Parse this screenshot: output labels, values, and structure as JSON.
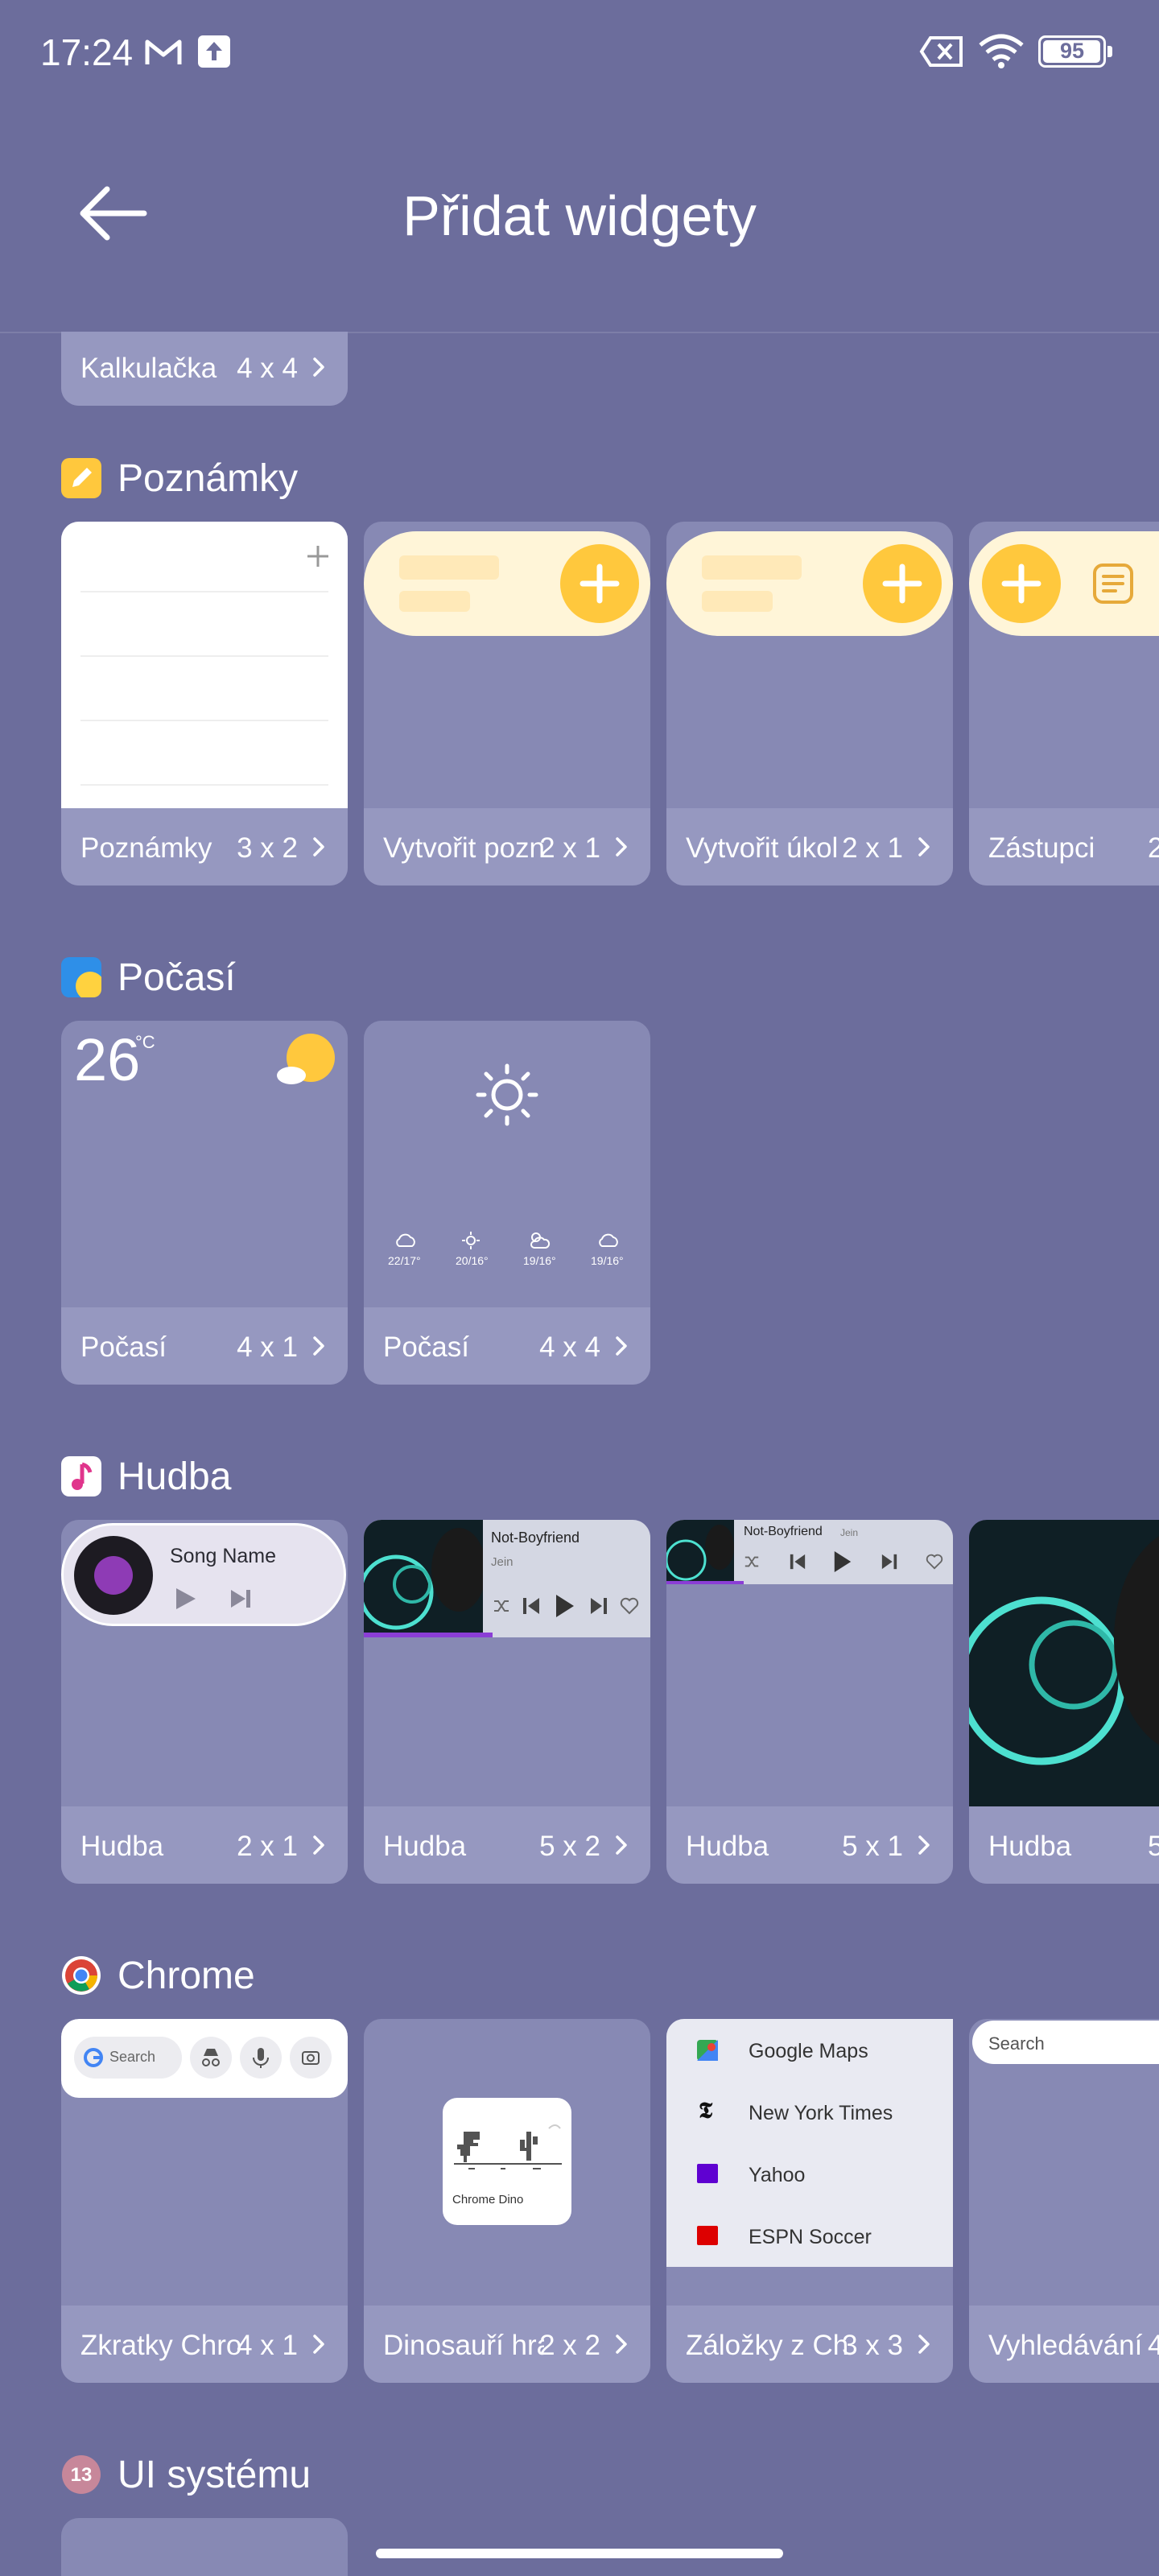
{
  "status_bar": {
    "time": "17:24",
    "battery": "95"
  },
  "header": {
    "title": "Přidat widgety"
  },
  "calc_card": {
    "name": "Kalkulačka",
    "size": "4 x 4"
  },
  "sections": {
    "notes": {
      "title": "Poznámky",
      "cards": [
        {
          "name": "Poznámky",
          "size": "3 x 2"
        },
        {
          "name": "Vytvořit pozn",
          "size": "2 x 1"
        },
        {
          "name": "Vytvořit úkol",
          "size": "2 x 1"
        },
        {
          "name": "Zástupci",
          "size": "2"
        }
      ]
    },
    "weather": {
      "title": "Počasí",
      "temp": "26",
      "unit": "°C",
      "forecast": [
        "22/17°",
        "20/16°",
        "19/16°",
        "19/16°"
      ],
      "cards": [
        {
          "name": "Počasí",
          "size": "4 x 1"
        },
        {
          "name": "Počasí",
          "size": "4 x 4"
        }
      ]
    },
    "music": {
      "title": "Hudba",
      "song_name": "Song Name",
      "track_title": "Not-Boyfriend",
      "track_artist": "Jein",
      "track_title_short": "Not-Boyfriend",
      "track_artist_short": "Jein",
      "cards": [
        {
          "name": "Hudba",
          "size": "2 x 1"
        },
        {
          "name": "Hudba",
          "size": "5 x 2"
        },
        {
          "name": "Hudba",
          "size": "5 x 1"
        },
        {
          "name": "Hudba",
          "size": "5"
        }
      ]
    },
    "chrome": {
      "title": "Chrome",
      "search_placeholder": "Search",
      "dino_label": "Chrome Dino",
      "bookmarks": [
        "Google Maps",
        "New York Times",
        "Yahoo",
        "ESPN Soccer"
      ],
      "search_small": "Search",
      "cards": [
        {
          "name": "Zkratky Chro",
          "size": "4 x 1"
        },
        {
          "name": "Dinosauří hra",
          "size": "2 x 2"
        },
        {
          "name": "Záložky z Ch",
          "size": "3 x 3"
        },
        {
          "name": "Vyhledávání",
          "size": "4"
        }
      ]
    },
    "system_ui": {
      "title": "UI systému"
    }
  },
  "colors": {
    "background": "#6c6d9c",
    "card": "#8789b4",
    "note_yellow": "#ffd24a",
    "note_cream": "#fff5d8"
  }
}
